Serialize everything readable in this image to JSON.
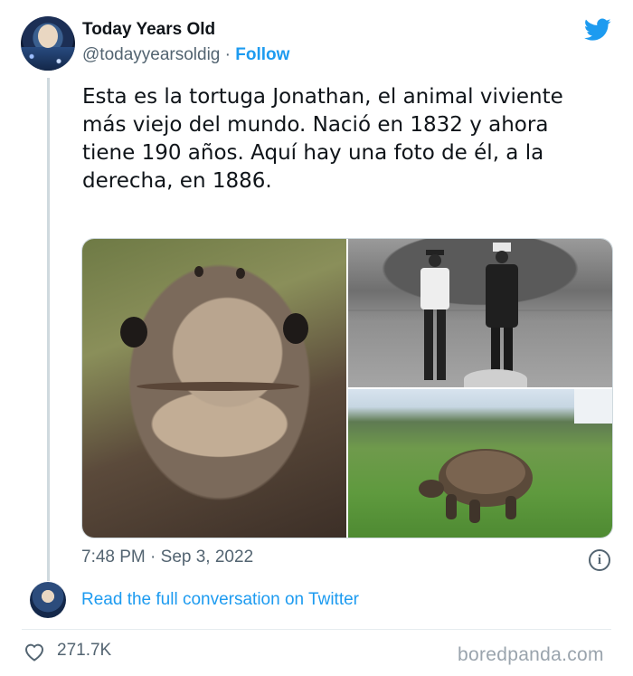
{
  "author": {
    "display_name": "Today Years Old",
    "handle": "@todayyearsoldig",
    "separator": "·",
    "follow_label": "Follow"
  },
  "tweet": {
    "text": "Esta es la tortuga Jonathan, el animal viviente más viejo del mundo. Nació en 1832 y ahora tiene 190 años. Aquí hay una foto de él, a la derecha, en 1886.",
    "time": "7:48 PM",
    "date_separator": "·",
    "date": "Sep 3, 2022",
    "info_glyph": "i"
  },
  "media": {
    "images": [
      "tortoise-face-closeup",
      "two-men-with-tortoise-1886",
      "tortoise-on-lawn"
    ]
  },
  "conversation": {
    "link_label": "Read the full conversation on Twitter"
  },
  "engagement": {
    "likes": "271.7K"
  },
  "watermark": "boredpanda.com",
  "colors": {
    "accent": "#1d9bf0",
    "text": "#0f1419",
    "muted": "#536471"
  },
  "icons": {
    "brand": "twitter-bird-icon",
    "like": "heart-icon",
    "info": "info-icon"
  }
}
